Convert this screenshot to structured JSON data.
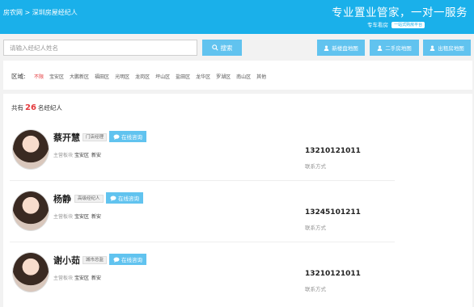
{
  "breadcrumb": {
    "site": "房农网",
    "sep": ">",
    "page": "深圳房屋经纪人"
  },
  "header": {
    "slogan": "专业置业管家，一对一服务",
    "sub": "专车看房",
    "sub_pill": "一站式购房平台"
  },
  "search": {
    "placeholder": "请输入经纪人姓名",
    "button": "搜索"
  },
  "actions": [
    {
      "label": "新楼盘地图"
    },
    {
      "label": "二手房地图"
    },
    {
      "label": "出租房地图"
    }
  ],
  "areas": {
    "label": "区域:",
    "items": [
      "不限",
      "宝安区",
      "大鹏新区",
      "福田区",
      "光明区",
      "龙岗区",
      "坪山区",
      "盐田区",
      "龙华区",
      "罗湖区",
      "南山区",
      "其他"
    ]
  },
  "count": {
    "prefix": "共有",
    "value": "26",
    "suffix": "名经纪人"
  },
  "agents": [
    {
      "name": "蔡开慧",
      "role": "门店经理",
      "consult": "在线咨询",
      "plate_label": "主营板块",
      "district": "宝安区",
      "location": "新安",
      "phone": "13210121011",
      "phone_label": "联系方式"
    },
    {
      "name": "杨静",
      "role": "高级经纪人",
      "consult": "在线咨询",
      "plate_label": "主营板块",
      "district": "宝安区",
      "location": "新安",
      "phone": "13245101211",
      "phone_label": "联系方式"
    },
    {
      "name": "谢小茹",
      "role": "城市总监",
      "consult": "在线咨询",
      "plate_label": "主营板块",
      "district": "宝安区",
      "location": "新安",
      "phone": "13210121011",
      "phone_label": "联系方式"
    }
  ],
  "colors": {
    "brand": "#1ab0ea",
    "button": "#61c3ef",
    "highlight": "#e4393c"
  }
}
